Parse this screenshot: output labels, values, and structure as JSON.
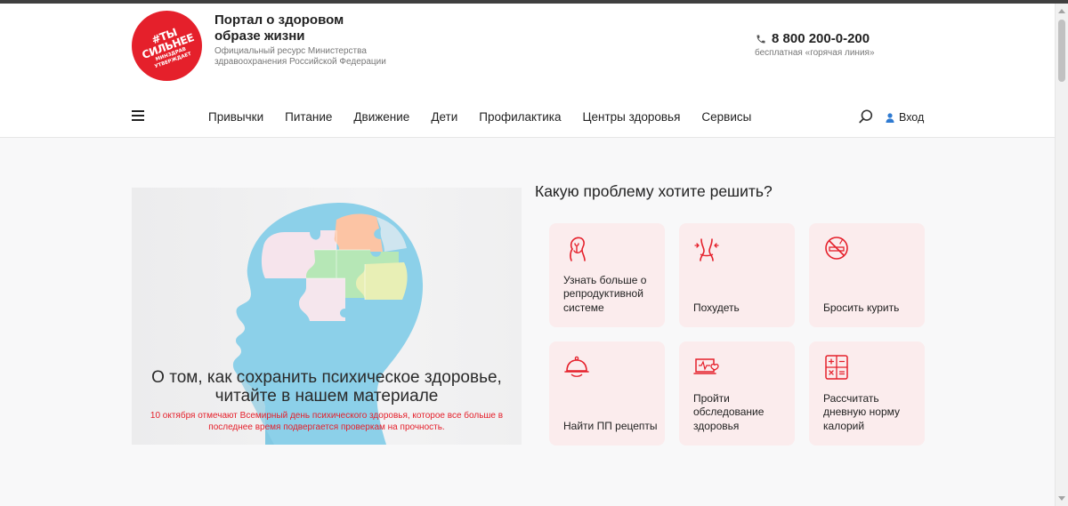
{
  "logo": {
    "line1": "#ТЫ",
    "line2": "СИЛЬНЕЕ",
    "line3": "МИНЗДРАВ",
    "line4": "УТВЕРЖДАЕТ"
  },
  "brand": {
    "title": "Портал о здоровом образе жизни",
    "subtitle": "Официальный ресурс Министерства здравоохранения Российской Федерации"
  },
  "contact": {
    "phone": "8 800 200-0-200",
    "phone_note": "бесплатная «горячая линия»"
  },
  "nav": {
    "items": [
      "Привычки",
      "Питание",
      "Движение",
      "Дети",
      "Профилактика",
      "Центры здоровья",
      "Сервисы"
    ]
  },
  "header": {
    "login_label": "Вход"
  },
  "banner": {
    "title": "О том, как сохранить психическое здоровье, читайте в нашем материале",
    "subtitle": "10 октября отмечают Всемирный день психического здоровья, которое все больше в последнее время подвергается проверкам на прочность."
  },
  "problems": {
    "title": "Какую проблему хотите решить?",
    "cards": [
      {
        "label": "Узнать больше о репродуктивной системе",
        "icon": "reproductive-icon"
      },
      {
        "label": "Похудеть",
        "icon": "waist-icon"
      },
      {
        "label": "Бросить курить",
        "icon": "no-smoking-icon"
      },
      {
        "label": "Найти ПП рецепты",
        "icon": "dish-icon"
      },
      {
        "label": "Пройти обследование здоровья",
        "icon": "checkup-icon"
      },
      {
        "label": "Рассчитать дневную норму калорий",
        "icon": "calculator-icon"
      }
    ]
  },
  "colors": {
    "accent": "#e5202b",
    "card_bg": "#fbeced",
    "page_bg": "#f8f8f9"
  }
}
